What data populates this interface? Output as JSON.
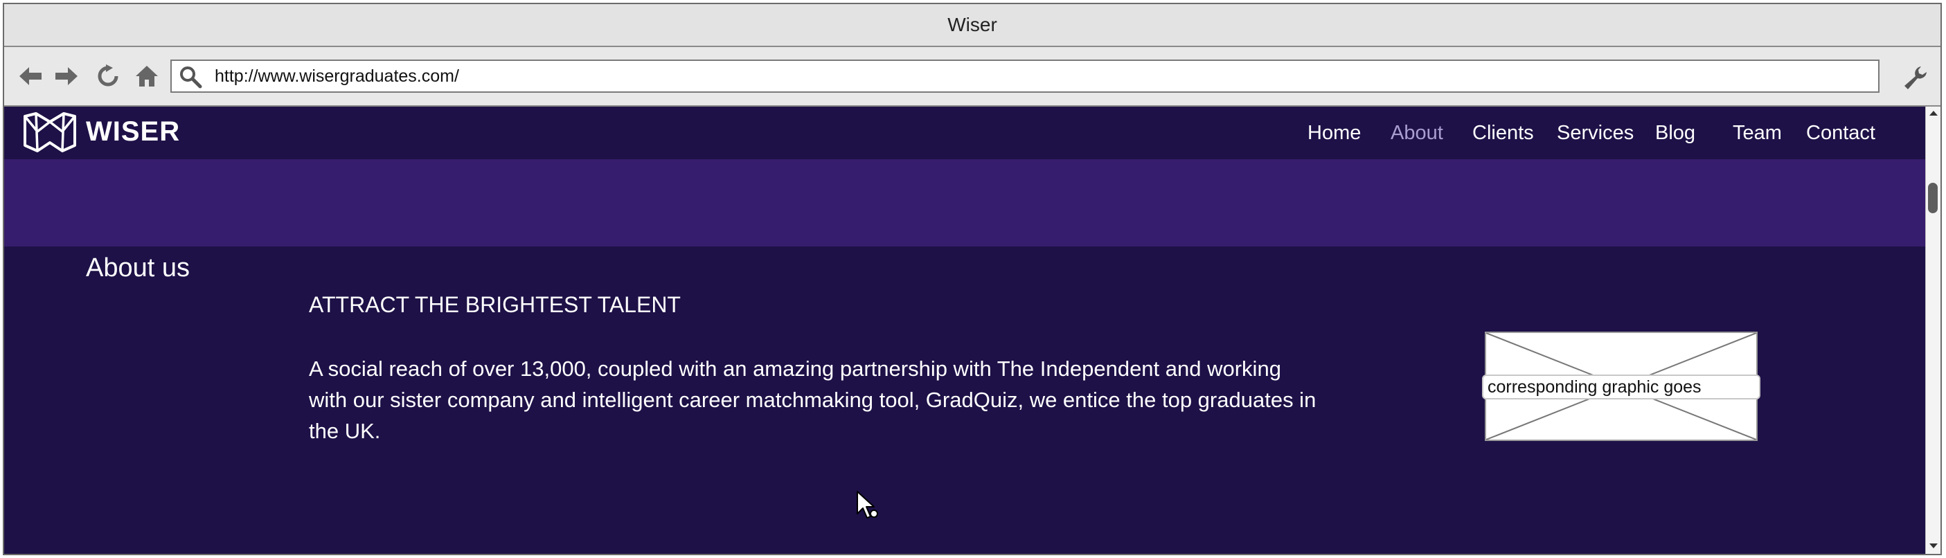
{
  "window": {
    "title": "Wiser"
  },
  "toolbar": {
    "url": "http://www.wisergraduates.com/",
    "back_icon": "back-arrow-icon",
    "forward_icon": "forward-arrow-icon",
    "reload_icon": "reload-icon",
    "home_icon": "home-icon",
    "search_icon": "search-icon",
    "settings_icon": "wrench-icon"
  },
  "site": {
    "brand": "WISER",
    "logo_icon": "wiser-logo-icon",
    "nav": [
      {
        "label": "Home",
        "active": false
      },
      {
        "label": "About",
        "active": true
      },
      {
        "label": "Clients",
        "active": false
      },
      {
        "label": "Services",
        "active": false
      },
      {
        "label": "Blog",
        "active": false
      },
      {
        "label": "Team",
        "active": false
      },
      {
        "label": "Contact",
        "active": false
      }
    ],
    "colors": {
      "nav_bg": "#1e1147",
      "hero_bg": "#371d6d",
      "active_link": "#a99ed0"
    }
  },
  "content": {
    "section_title": "About us",
    "headline": "ATTRACT THE BRIGHTEST TALENT",
    "body": "A social reach of over 13,000, coupled with an amazing partnership with The Independent and working with our sister company and intelligent career matchmaking tool, GradQuiz, we entice the top graduates in the UK.",
    "image_placeholder_caption": "corresponding graphic goes"
  }
}
